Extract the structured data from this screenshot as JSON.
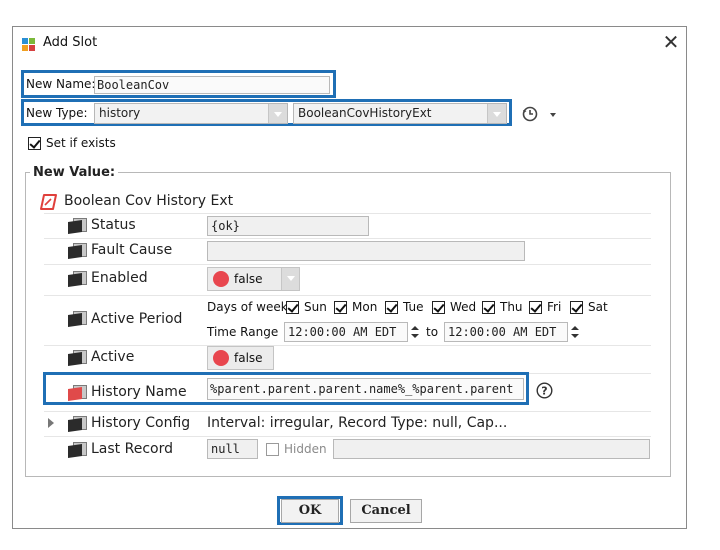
{
  "dialog": {
    "title": "Add Slot",
    "close_glyph": "✕"
  },
  "new_name": {
    "label": "New Name:",
    "value": "BooleanCov"
  },
  "new_type": {
    "label": "New Type:",
    "module": "history",
    "type": "BooleanCovHistoryExt"
  },
  "set_if_exists": {
    "label": "Set if exists",
    "checked": true
  },
  "new_value": {
    "group_label": "New Value:",
    "root": "Boolean Cov History Ext",
    "status": {
      "label": "Status",
      "value": "{ok}"
    },
    "fault_cause": {
      "label": "Fault Cause",
      "value": ""
    },
    "enabled": {
      "label": "Enabled",
      "value": "false"
    },
    "active_period": {
      "label": "Active Period",
      "days_label": "Days of week",
      "days": [
        "Sun",
        "Mon",
        "Tue",
        "Wed",
        "Thu",
        "Fri",
        "Sat"
      ],
      "time_range_label": "Time Range",
      "start": "12:00:00 AM EDT",
      "to_label": "to",
      "end": "12:00:00 AM EDT"
    },
    "active": {
      "label": "Active",
      "value": "false"
    },
    "history_name": {
      "label": "History Name",
      "value": "%parent.parent.parent.name%_%parent.parent"
    },
    "history_config": {
      "label": "History Config",
      "value": "Interval: irregular, Record Type: null, Cap..."
    },
    "last_record": {
      "label": "Last Record",
      "value": "null",
      "hidden_label": "Hidden"
    }
  },
  "buttons": {
    "ok": "OK",
    "cancel": "Cancel"
  },
  "icons": {
    "app": "add-slot-icon",
    "history": "clock-icon",
    "root": "history-ext-icon",
    "slot": "slot-icon"
  },
  "colors": {
    "highlight": "#1f6fb5",
    "false_dot": "#e8464e",
    "root_icon": "#e0403c"
  }
}
